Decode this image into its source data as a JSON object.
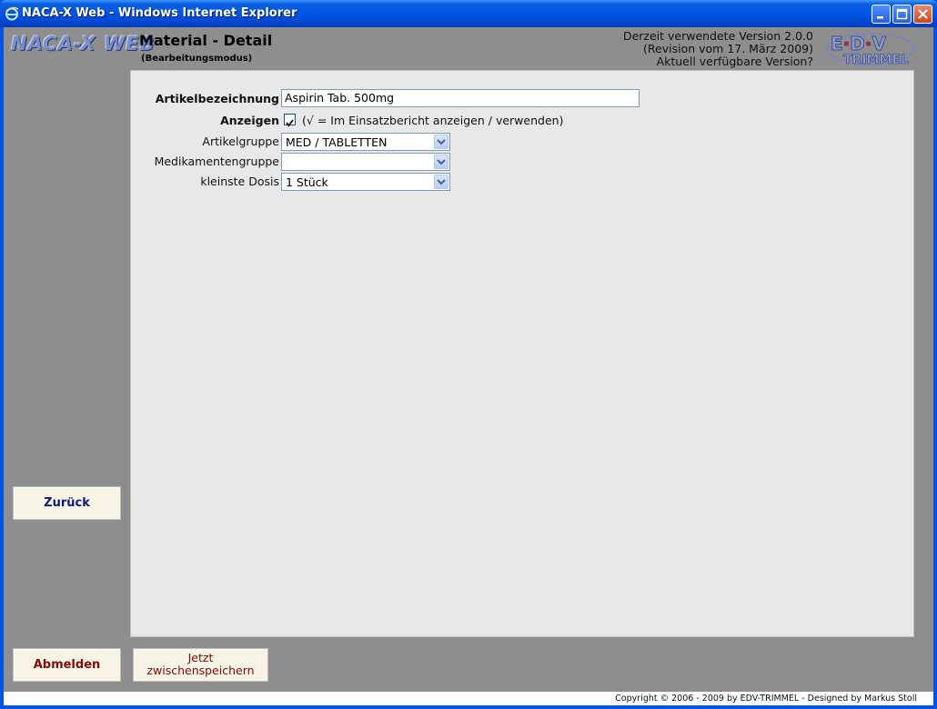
{
  "window": {
    "title": "NACA-X Web - Windows Internet Explorer",
    "accent_color": "#0054e3"
  },
  "header": {
    "logo_text": "NACA-X WEB",
    "page_title": "Material - Detail",
    "page_subtitle": "(Bearbeitungsmodus)",
    "version_line1": "Derzeit verwendete Version 2.0.0",
    "version_line2": "(Revision vom 17. März 2009)",
    "version_line3": "Aktuell verfügbare Version?",
    "edv_logo_text": "EDV TRIMMEL"
  },
  "form": {
    "article_label": "Artikelbezeichnung",
    "article_value": "Aspirin Tab. 500mg",
    "display_label": "Anzeigen",
    "display_checked": true,
    "display_note": "(√  = Im Einsatzbericht anzeigen / verwenden)",
    "group_label": "Artikelgruppe",
    "group_value": "MED / TABLETTEN",
    "medgroup_label": "Medikamentengruppe",
    "medgroup_value": "",
    "dose_label": "kleinste Dosis",
    "dose_value": "1 Stück"
  },
  "buttons": {
    "back_label": "Zurück",
    "logout_label": "Abmelden",
    "save_label_line1": "Jetzt",
    "save_label_line2": "zwischenspeichern"
  },
  "footer": {
    "copyright": "Copyright © 2006 - 2009 by EDV-TRIMMEL - Designed by Markus Stoll"
  }
}
